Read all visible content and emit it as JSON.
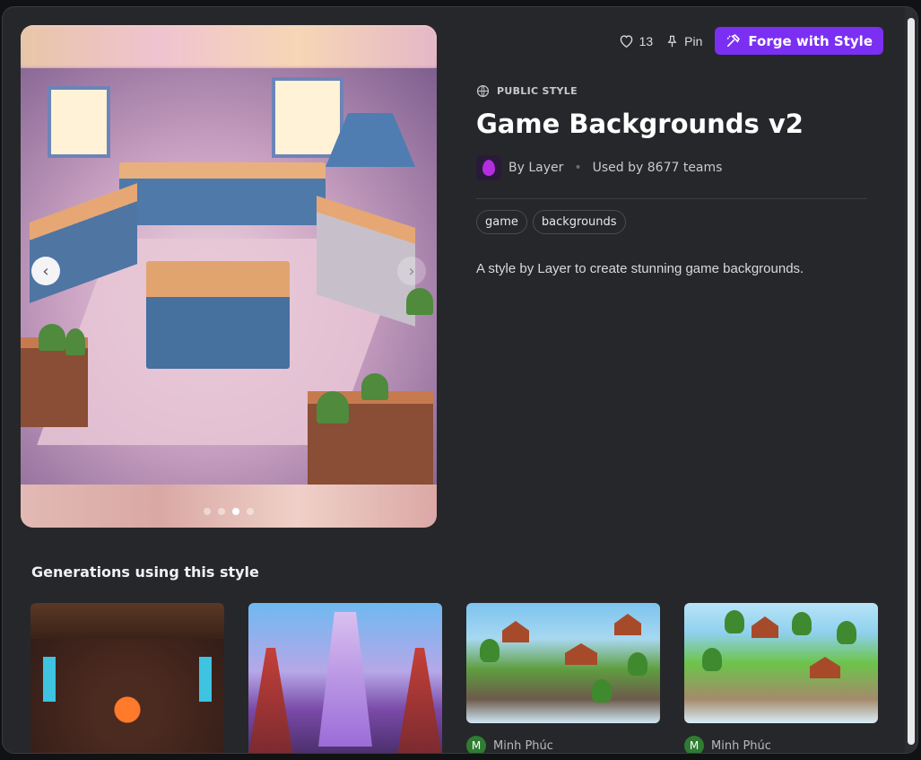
{
  "actions": {
    "likes_count": "13",
    "pin_label": "Pin",
    "forge_label": "Forge with Style"
  },
  "style": {
    "visibility_label": "PUBLIC STYLE",
    "title": "Game Backgrounds v2",
    "author": "By Layer",
    "usage": "Used by 8677 teams",
    "tags": [
      "game",
      "backgrounds"
    ],
    "description": "A style by Layer to create stunning game backgrounds."
  },
  "carousel": {
    "total_slides": 4,
    "active_slide": 3
  },
  "generations": {
    "heading": "Generations using this style",
    "items": [
      {
        "user": "",
        "initial": ""
      },
      {
        "user": "",
        "initial": ""
      },
      {
        "user": "Minh Phúc",
        "initial": "M"
      },
      {
        "user": "Minh Phúc",
        "initial": "M"
      }
    ]
  },
  "colors": {
    "accent": "#7b2ff2",
    "background": "#26272b"
  }
}
